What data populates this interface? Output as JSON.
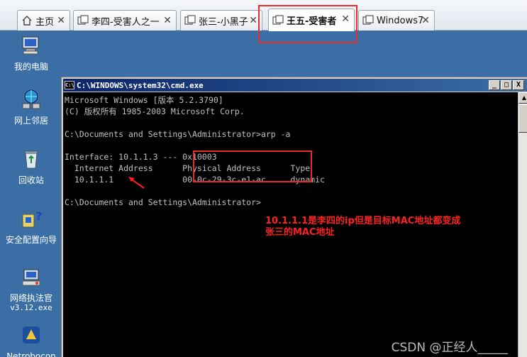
{
  "tabs": [
    {
      "label": "主页",
      "icon": "home-icon",
      "active": false
    },
    {
      "label": "李四-受害人之一",
      "icon": "vm-icon",
      "active": false
    },
    {
      "label": "张三-小黑子",
      "icon": "vm-icon",
      "active": false
    },
    {
      "label": "王五-受害者",
      "icon": "vm-icon",
      "active": true
    },
    {
      "label": "Windows7",
      "icon": "vm-icon",
      "active": false
    }
  ],
  "tab_close_glyph": "✕",
  "desktop": {
    "icons": [
      {
        "label": "我的电脑",
        "icon": "my-computer-icon"
      },
      {
        "label": "网上邻居",
        "icon": "network-neighborhood-icon"
      },
      {
        "label": "回收站",
        "icon": "recycle-bin-icon"
      },
      {
        "label": "安全配置向导",
        "icon": "security-wizard-icon"
      },
      {
        "label": "网络执法官",
        "label2": "v3.12.exe",
        "icon": "network-enforcer-icon"
      },
      {
        "label": "Netrobocon",
        "icon": "netrobocon-icon"
      }
    ]
  },
  "cmd": {
    "title": "C:\\WINDOWS\\system32\\cmd.exe",
    "icon_text": "C:\\",
    "buttons": {
      "minimize": "_",
      "maximize": "□",
      "close": "X"
    },
    "lines": [
      "Microsoft Windows [版本 5.2.3790]",
      "(C) 版权所有 1985-2003 Microsoft Corp.",
      "",
      "C:\\Documents and Settings\\Administrator>arp -a",
      "",
      "Interface: 10.1.1.3 --- 0x10003",
      "  Internet Address      Physical Address      Type",
      "  10.1.1.1              00-0c-29-3c-e1-ac     dynamic",
      "",
      "C:\\Documents and Settings\\Administrator>"
    ]
  },
  "annotation": {
    "line1": "10.1.1.1是李四的ip但是目标MAC地址都变成",
    "line2": "张三的MAC地址"
  },
  "watermark": "CSDN @正经人_____",
  "colors": {
    "highlight": "#e52b2b",
    "annotation": "#ff2020",
    "titlebar": "#0a246a"
  }
}
